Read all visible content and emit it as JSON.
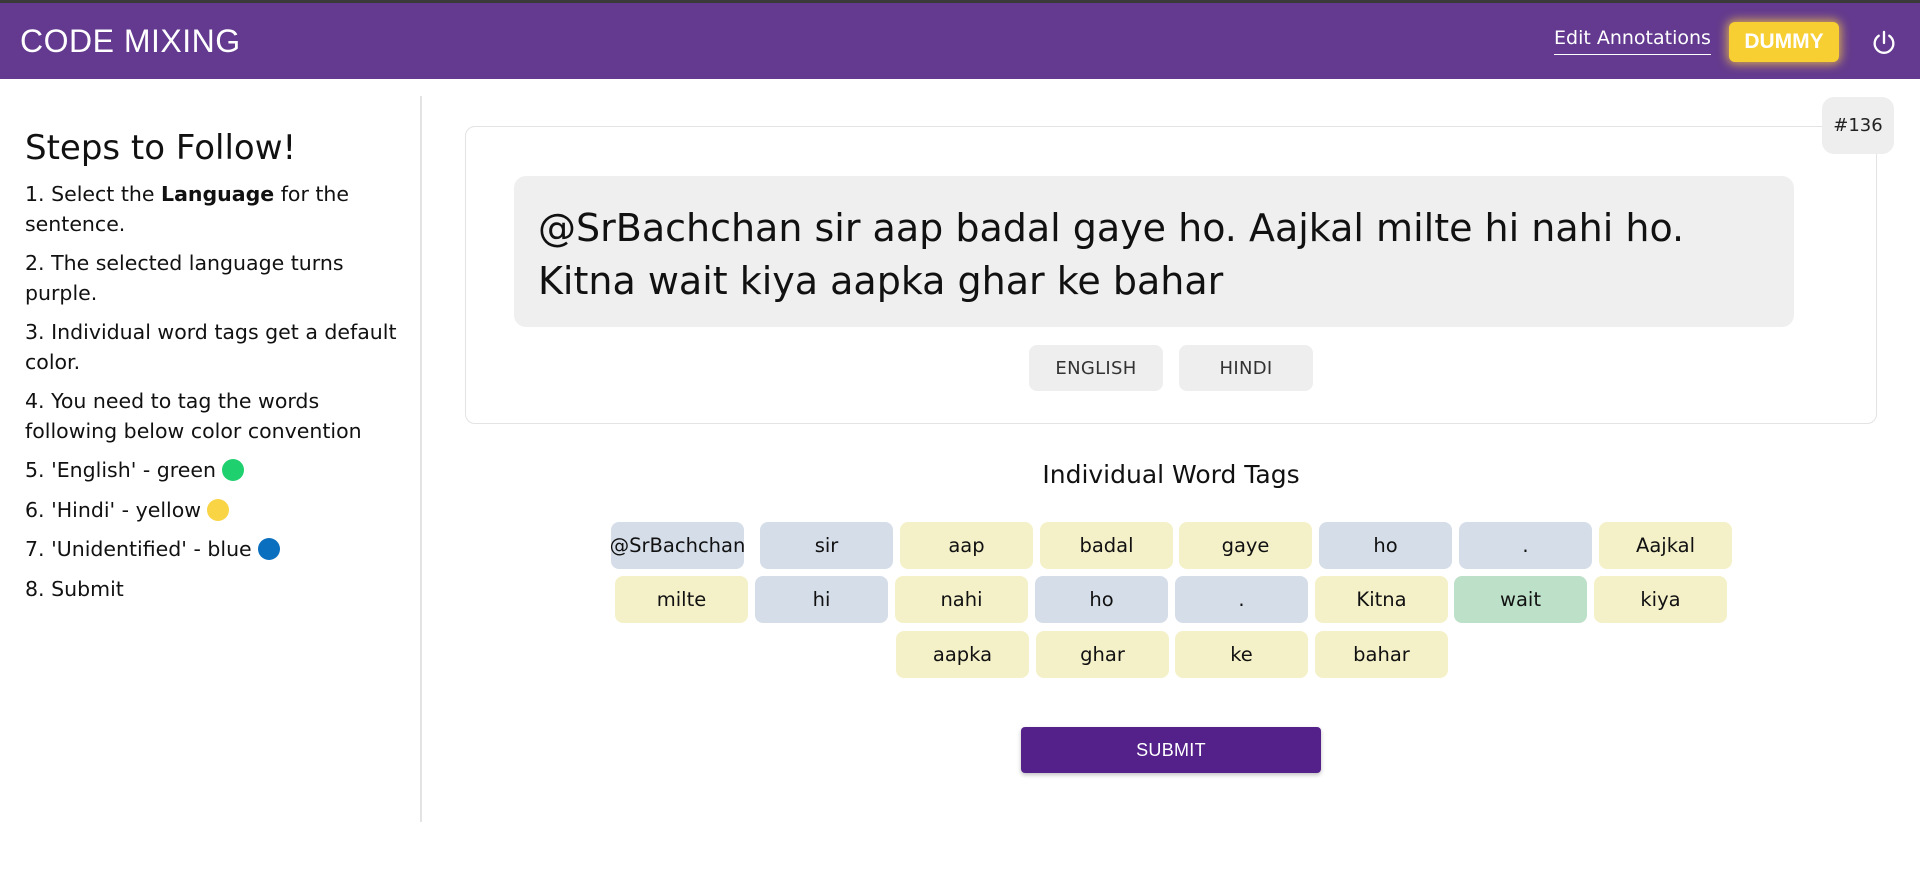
{
  "header": {
    "brand": "CODE MIXING",
    "edit_link": "Edit Annotations",
    "user_button": "DUMMY",
    "power_icon": "power-icon"
  },
  "sidebar": {
    "title": "Steps to Follow!",
    "step1_pre": "1. Select the ",
    "step1_bold": "Language",
    "step1_post": " for the sentence.",
    "step2": "2. The selected language turns purple.",
    "step3": "3. Individual word tags get a default color.",
    "step4": "4. You need to tag the words following below color convention",
    "step5": "5. 'English' - green",
    "step6": "6. 'Hindi' - yellow",
    "step7": "7. 'Unidentified' - blue",
    "step8": "8. Submit",
    "colors": {
      "english": "#1fd06e",
      "hindi": "#f9d444",
      "unidentified": "#0a6fbf"
    }
  },
  "annotation": {
    "id_badge": "#136",
    "sentence": "@SrBachchan sir aap badal gaye ho. Aajkal milte hi nahi ho. Kitna wait kiya aapka ghar ke bahar",
    "languages": [
      "ENGLISH",
      "HINDI"
    ]
  },
  "word_tags": {
    "heading": "Individual Word Tags",
    "tag_colors": {
      "hindi": "#f4f1c9",
      "unidentified": "#d5dde8",
      "english": "#bde0c9"
    },
    "tags": [
      {
        "word": "@SrBachchan",
        "tag": "unidentified"
      },
      {
        "word": "sir",
        "tag": "unidentified"
      },
      {
        "word": "aap",
        "tag": "hindi"
      },
      {
        "word": "badal",
        "tag": "hindi"
      },
      {
        "word": "gaye",
        "tag": "hindi"
      },
      {
        "word": "ho",
        "tag": "unidentified"
      },
      {
        "word": ".",
        "tag": "unidentified"
      },
      {
        "word": "Aajkal",
        "tag": "hindi"
      },
      {
        "word": "milte",
        "tag": "hindi"
      },
      {
        "word": "hi",
        "tag": "unidentified"
      },
      {
        "word": "nahi",
        "tag": "hindi"
      },
      {
        "word": "ho",
        "tag": "unidentified"
      },
      {
        "word": ".",
        "tag": "unidentified"
      },
      {
        "word": "Kitna",
        "tag": "hindi"
      },
      {
        "word": "wait",
        "tag": "english"
      },
      {
        "word": "kiya",
        "tag": "hindi"
      },
      {
        "word": "aapka",
        "tag": "hindi"
      },
      {
        "word": "ghar",
        "tag": "hindi"
      },
      {
        "word": "ke",
        "tag": "hindi"
      },
      {
        "word": "bahar",
        "tag": "hindi"
      }
    ]
  },
  "submit_label": "SUBMIT"
}
